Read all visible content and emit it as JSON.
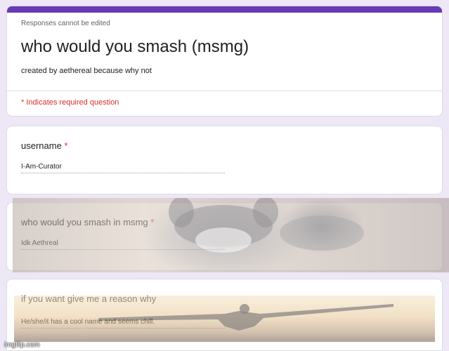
{
  "form": {
    "responses_note": "Responses cannot be edited",
    "title": "who would you smash (msmg)",
    "description": "created by aethereal because why not",
    "required_note": "* Indicates required question"
  },
  "questions": [
    {
      "label": "username",
      "required_star": "*",
      "answer": "I-Am-Curator"
    },
    {
      "label": "who would you smash in msmg",
      "required_star": "*",
      "answer": "Idk Aethreal"
    },
    {
      "label": "if you want give me a reason why",
      "answer": "He/she/it has a cool name and seems chill."
    }
  ],
  "watermark": "imgflip.com",
  "colors": {
    "accent": "#673ab7",
    "background": "#ede7f6",
    "required": "#d93025"
  }
}
